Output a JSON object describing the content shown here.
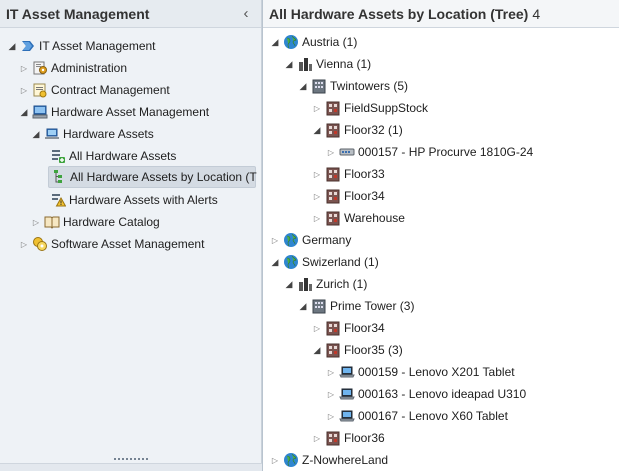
{
  "left_panel": {
    "title": "IT Asset Management",
    "collapse_glyph": "‹",
    "tree": [
      {
        "label": "IT Asset Management",
        "icon": "it-asset-icon"
      },
      {
        "label": "Administration",
        "icon": "administration-icon"
      },
      {
        "label": "Contract Management",
        "icon": "contract-icon"
      },
      {
        "label": "Hardware Asset Management",
        "icon": "hardware-management-icon"
      },
      {
        "label": "Hardware Assets",
        "icon": "hardware-assets-icon"
      },
      {
        "label": "All Hardware Assets",
        "icon": "all-assets-icon"
      },
      {
        "label": "All Hardware Assets by Location (T",
        "icon": "tree-location-icon"
      },
      {
        "label": "Hardware Assets with Alerts",
        "icon": "alerts-icon"
      },
      {
        "label": "Hardware Catalog",
        "icon": "catalog-book-icon"
      },
      {
        "label": "Software Asset Management",
        "icon": "software-icon"
      }
    ]
  },
  "right_panel": {
    "title": "All Hardware Assets by Location (Tree)",
    "count": "4",
    "tree": [
      {
        "label": "Austria (1)",
        "icon": "globe-icon"
      },
      {
        "label": "Vienna (1)",
        "icon": "city-icon"
      },
      {
        "label": "Twintowers (5)",
        "icon": "building-icon"
      },
      {
        "label": "FieldSuppStock",
        "icon": "room-icon"
      },
      {
        "label": "Floor32 (1)",
        "icon": "room-icon"
      },
      {
        "label": "000157 - HP Procurve 1810G-24",
        "icon": "switch-icon"
      },
      {
        "label": "Floor33",
        "icon": "room-icon"
      },
      {
        "label": "Floor34",
        "icon": "room-icon"
      },
      {
        "label": "Warehouse",
        "icon": "room-icon"
      },
      {
        "label": "Germany",
        "icon": "globe-icon"
      },
      {
        "label": "Swizerland (1)",
        "icon": "globe-icon"
      },
      {
        "label": "Zurich (1)",
        "icon": "city-icon"
      },
      {
        "label": "Prime Tower (3)",
        "icon": "building-icon"
      },
      {
        "label": "Floor34",
        "icon": "room-icon"
      },
      {
        "label": "Floor35 (3)",
        "icon": "room-icon"
      },
      {
        "label": "000159 - Lenovo X201 Tablet",
        "icon": "laptop-icon"
      },
      {
        "label": "000163 - Lenovo ideapad U310",
        "icon": "laptop-icon"
      },
      {
        "label": "000167 - Lenovo X60 Tablet",
        "icon": "laptop-icon"
      },
      {
        "label": "Floor36",
        "icon": "room-icon"
      },
      {
        "label": "Z-NowhereLand",
        "icon": "globe-icon"
      }
    ]
  }
}
